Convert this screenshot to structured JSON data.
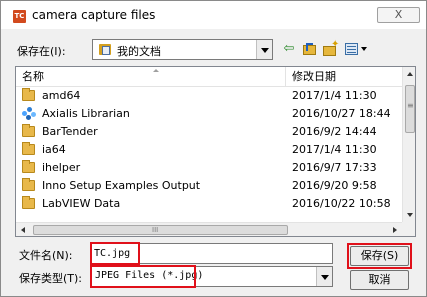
{
  "window": {
    "title": "camera capture files",
    "app_icon": "TC",
    "close_label": "X"
  },
  "toolbar": {
    "look_in_label": "保存在(I):",
    "look_in_value": "我的文档",
    "icons": [
      "back-arrow-icon",
      "up-folder-icon",
      "new-folder-icon",
      "view-menu-icon"
    ]
  },
  "list": {
    "columns": {
      "name": "名称",
      "date": "修改日期"
    },
    "rows": [
      {
        "name": "amd64",
        "date": "2017/1/4 11:30",
        "icon": "folder-icon"
      },
      {
        "name": "Axialis Librarian",
        "date": "2016/10/27 18:44",
        "icon": "special-folder-icon"
      },
      {
        "name": "BarTender",
        "date": "2016/9/2 14:44",
        "icon": "folder-icon"
      },
      {
        "name": "ia64",
        "date": "2017/1/4 11:30",
        "icon": "folder-icon"
      },
      {
        "name": "ihelper",
        "date": "2016/9/7 17:33",
        "icon": "folder-icon"
      },
      {
        "name": "Inno Setup Examples Output",
        "date": "2016/9/20 9:58",
        "icon": "folder-icon"
      },
      {
        "name": "LabVIEW Data",
        "date": "2016/10/22 10:58",
        "icon": "folder-icon"
      }
    ],
    "hscroll_grip": "III"
  },
  "footer": {
    "filename_label": "文件名(N):",
    "filename_value": "TC.jpg",
    "filetype_label": "保存类型(T):",
    "filetype_value": "JPEG Files (*.jpg)",
    "save_label": "保存(S)",
    "cancel_label": "取消"
  },
  "colors": {
    "highlight": "#e0101a",
    "folder": "#e8b84a",
    "app_icon_bg": "#d24a1e"
  }
}
